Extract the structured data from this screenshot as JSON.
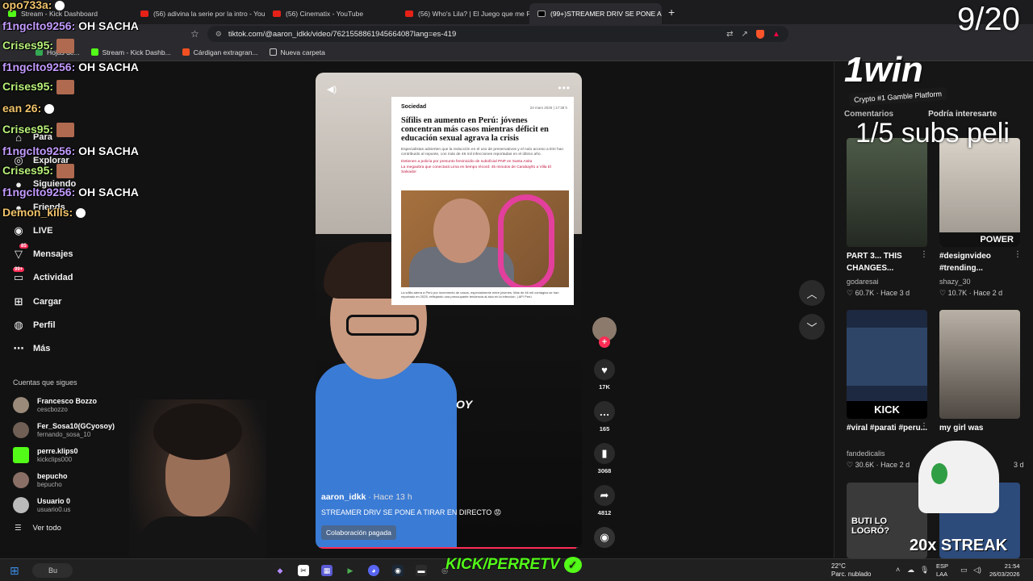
{
  "browser": {
    "tabs": [
      {
        "label": "Stream - Kick Dashboard",
        "favicon": "kick"
      },
      {
        "label": "(56) adivina la serie por la intro - You",
        "favicon": "youtube"
      },
      {
        "label": "(56) Cinematix - YouTube",
        "favicon": "youtube"
      },
      {
        "label": "(56) Who's Lila? | El Juego que me Re",
        "favicon": "youtube"
      },
      {
        "label": "(99+)STREAMER DRIV SE PONE A",
        "favicon": "tiktok"
      }
    ],
    "url": "tiktok.com/@aaron_idkk/video/7621558861945664087lang=es-419",
    "bookmarks": [
      "Hojas de...",
      "Stream - Kick Dashb...",
      "Cárdigan extragran...",
      "Nueva carpeta"
    ]
  },
  "sidebar": {
    "nav": [
      {
        "label": "Para",
        "icon": "home-icon"
      },
      {
        "label": "Explorar",
        "icon": "compass-icon"
      },
      {
        "label": "Siguiendo",
        "icon": "following-icon"
      },
      {
        "label": "Friends",
        "icon": "friends-icon"
      },
      {
        "label": "LIVE",
        "icon": "live-icon"
      },
      {
        "label": "Mensajes",
        "icon": "messages-icon",
        "badge": "85"
      },
      {
        "label": "Actividad",
        "icon": "activity-icon",
        "badge": "99+"
      },
      {
        "label": "Cargar",
        "icon": "upload-icon"
      },
      {
        "label": "Perfil",
        "icon": "profile-icon"
      },
      {
        "label": "Más",
        "icon": "more-icon"
      }
    ],
    "following_title": "Cuentas que sigues",
    "accounts": [
      {
        "name": "Francesco Bozzo",
        "handle": "cescbozzo"
      },
      {
        "name": "Fer_Sosa10(GCyosoy)",
        "handle": "fernando_sosa_10"
      },
      {
        "name": "perre.klips0",
        "handle": "kickclips000"
      },
      {
        "name": "bepucho",
        "handle": "bepucho"
      },
      {
        "name": "Usuario 0",
        "handle": "usuario0.us"
      }
    ],
    "see_all": "Ver todo"
  },
  "video": {
    "article": {
      "section": "Sociedad",
      "date": "24 mars 2026 | 17:38 h",
      "headline": "Sífilis en aumento en Perú: jóvenes concentran más casos mientras déficit en educación sexual agrava la crisis",
      "lead": "Especialistas advierten que la reducción en el uso de preservativos y el nulo acceso a ESI han contribuido al repunte, con más de 46 mil infecciones reportadas en el último año.",
      "links": [
        "Detienen a policía por presunto feminicidio de suboficial PNP en Santa Anita",
        "La megaobra que conectará Lima en tiempo récord: 45 minutos de Carabayllo a Villa El Salvador"
      ],
      "caption": "La sífilis aterra a Perú por incremento de casos, especialmente entre jóvenes. Más de 46 mil contagios se han reportado en 2025, reflejando una preocupante tendencia al alza en la infección. | AP/ Perú"
    },
    "overlay_tag": "OY",
    "author": "aaron_idkk",
    "time": "· Hace 13 h",
    "description": "STREAMER DRIV SE PONE A TIRAR EN DIRECTO 😡",
    "paid_label": "Colaboración pagada",
    "progress": 0.98
  },
  "actions": {
    "likes": "17K",
    "comments": "165",
    "saves": "3068",
    "shares": "4812"
  },
  "right_panel": {
    "tabs": [
      "Comentarios",
      "Podría interesarte"
    ],
    "cards": [
      {
        "title": "PART 3... THIS CHANGES...",
        "user": "godaresai",
        "stats": "♡ 60.7K · Hace 3 d",
        "thumb_text": "",
        "color": "#3d4a3a"
      },
      {
        "title": "#designvideo #trending...",
        "user": "shazy_30",
        "stats": "♡ 10.7K · Hace 2 d",
        "thumb_text": "POWER",
        "color": "#c5c0b8"
      },
      {
        "title": "#viral #parati #peru...",
        "user": "fandedicalis",
        "stats": "♡ 30.6K · Hace 2 d",
        "thumb_text": "KICK",
        "color": "#2a3b5a"
      },
      {
        "title": "my girl was",
        "user": "",
        "stats": "3 d",
        "thumb_text": "",
        "color": "#7a746c"
      },
      {
        "title": "",
        "user": "",
        "stats": "",
        "thumb_text": "BUTI LO LOGRÓ?",
        "color": "#3a3a3a"
      },
      {
        "title": "",
        "user": "",
        "stats": "",
        "thumb_text": "",
        "color": "#2c4a7a"
      }
    ]
  },
  "stream_overlay": {
    "chat": [
      {
        "user": "opo733a:",
        "msg": "",
        "emote": "skull"
      },
      {
        "user": "f1ngclto9256:",
        "msg": "OH SACHA"
      },
      {
        "user": "Crises95:",
        "msg": "",
        "emote": "face"
      },
      {
        "user": "f1ngclto9256:",
        "msg": "OH SACHA"
      },
      {
        "user": "Crises95:",
        "msg": "",
        "emote": "face"
      },
      {
        "user": "ean 26:",
        "msg": "",
        "emote": "skull"
      },
      {
        "user": "Crises95:",
        "msg": "",
        "emote": "face"
      },
      {
        "user": "f1ngclto9256:",
        "msg": "OH SACHA"
      },
      {
        "user": "Crises95:",
        "msg": "",
        "emote": "face"
      },
      {
        "user": "f1ngclto9256:",
        "msg": "OH SACHA"
      },
      {
        "user": "Demon_kills:",
        "msg": "",
        "emote": "skull"
      }
    ],
    "counter": "9/20",
    "brand": "1win",
    "brand_sub": "Crypto #1 Gamble Platform",
    "subs": "1/5 subs peli",
    "kick_handle": "KICK/PERRETV",
    "streak": "20x STREAK"
  },
  "taskbar": {
    "search": "Bu",
    "weather_temp": "22°C",
    "weather_desc": "Parc. nublado",
    "lang_top": "ESP",
    "lang_bottom": "LAA",
    "time": "21:54",
    "date": "26/03/2026"
  }
}
